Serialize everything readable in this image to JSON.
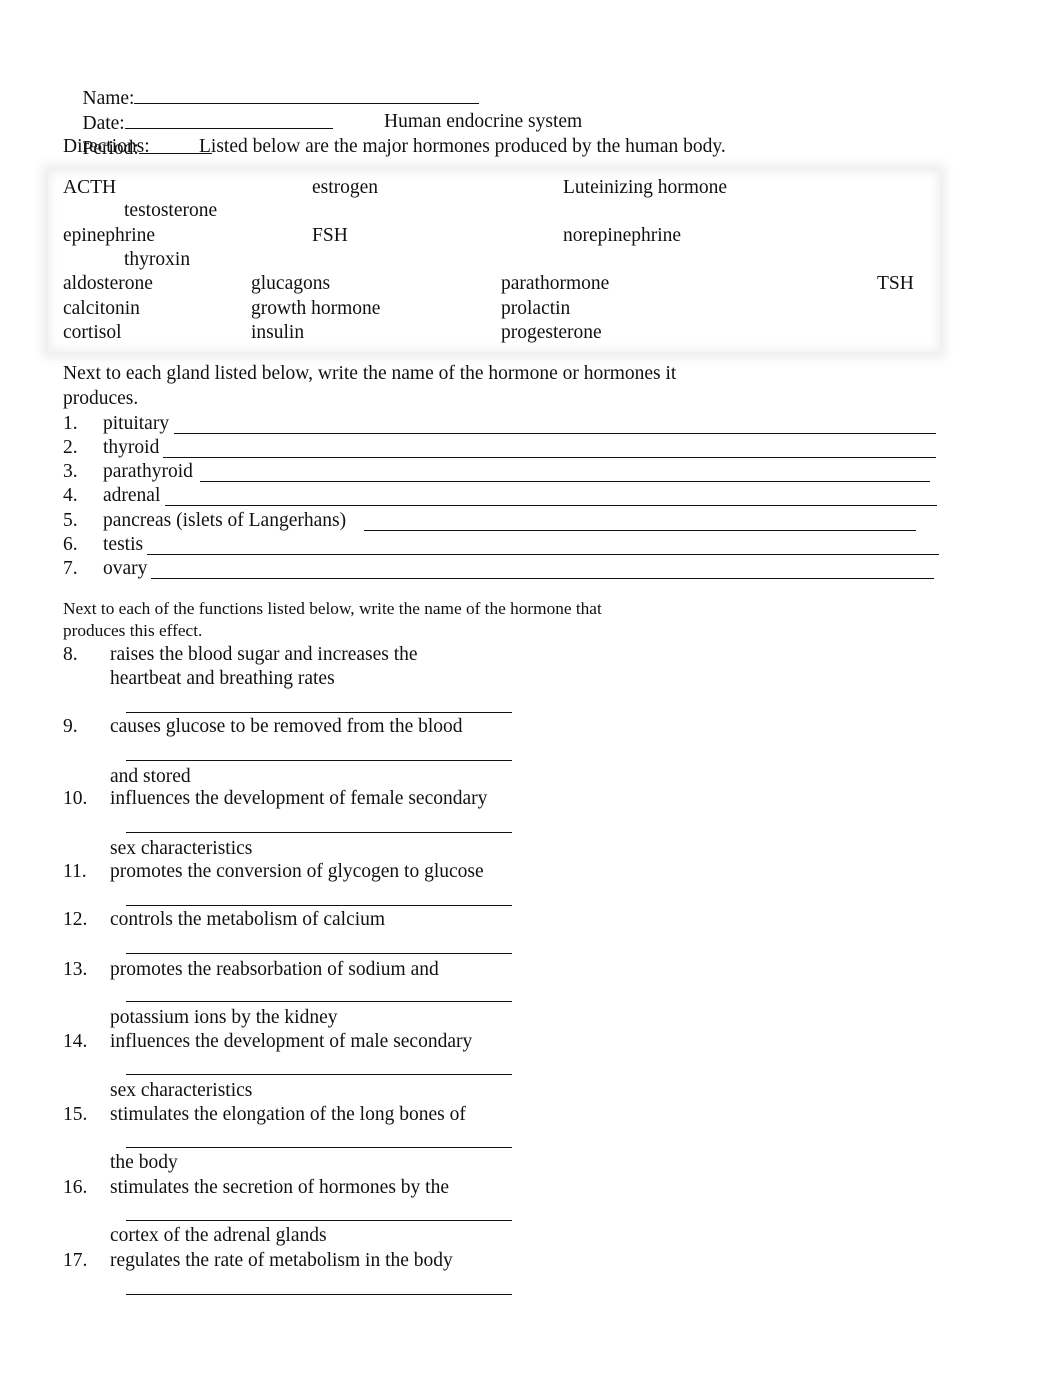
{
  "header": {
    "name_label": "Name:",
    "date_label": "Date:",
    "period_label": "Period:"
  },
  "title": "Human endocrine system",
  "directions": {
    "label": "Directions:",
    "text": "Listed below are the major hormones produced by the human body."
  },
  "hormone_bank": {
    "row1": [
      "ACTH",
      "estrogen",
      "Luteinizing hormone"
    ],
    "row1_wrap": "testosterone",
    "row2": [
      "epinephrine",
      "FSH",
      "norepinephrine"
    ],
    "row2_wrap": "thyroxin",
    "row3": [
      "aldosterone",
      "glucagons",
      "parathormone",
      "TSH"
    ],
    "row4": [
      "calcitonin",
      "growth hormone",
      "prolactin"
    ],
    "row5": [
      "cortisol",
      "insulin",
      "progesterone"
    ]
  },
  "section1": {
    "instructions_line1": "Next to each gland listed below, write the name of the hormone or hormones it",
    "instructions_line2": "produces.",
    "items": [
      {
        "number": "1.",
        "gland": "pituitary",
        "answer": ""
      },
      {
        "number": "2.",
        "gland": "thyroid",
        "answer": ""
      },
      {
        "number": "3.",
        "gland": "parathyroid",
        "answer": ""
      },
      {
        "number": "4.",
        "gland": "adrenal",
        "answer": ""
      },
      {
        "number": "5.",
        "gland": "pancreas (islets of Langerhans)",
        "answer": ""
      },
      {
        "number": "6.",
        "gland": "testis",
        "answer": ""
      },
      {
        "number": "7.",
        "gland": "ovary",
        "answer": ""
      }
    ]
  },
  "section2": {
    "instructions_line1": "Next to each of the functions listed below, write the name of the hormone that",
    "instructions_line2": "produces this effect.",
    "items": [
      {
        "number": "8.",
        "line1": "raises the blood sugar and increases the",
        "line2": "heartbeat and breathing rates",
        "answer": ""
      },
      {
        "number": "9.",
        "line1": "causes glucose to be removed from the blood",
        "line2": "and stored",
        "answer": ""
      },
      {
        "number": "10.",
        "line1": "influences the development of female secondary",
        "line2": "sex characteristics",
        "answer": ""
      },
      {
        "number": "11.",
        "line1": "promotes the conversion of glycogen to glucose",
        "line2": "",
        "answer": ""
      },
      {
        "number": "12.",
        "line1": "controls the metabolism of calcium",
        "line2": "",
        "answer": ""
      },
      {
        "number": "13.",
        "line1": "promotes the reabsorbation of sodium and",
        "line2": "potassium ions by the kidney",
        "answer": ""
      },
      {
        "number": "14.",
        "line1": "influences the development of male secondary",
        "line2": "sex characteristics",
        "answer": ""
      },
      {
        "number": "15.",
        "line1": "stimulates the elongation of the long bones of",
        "line2": "the body",
        "answer": ""
      },
      {
        "number": "16.",
        "line1": "stimulates the secretion of hormones by the",
        "line2": "cortex of the adrenal glands",
        "answer": ""
      },
      {
        "number": "17.",
        "line1": "regulates the rate of metabolism in the body",
        "line2": "",
        "answer": ""
      }
    ]
  }
}
